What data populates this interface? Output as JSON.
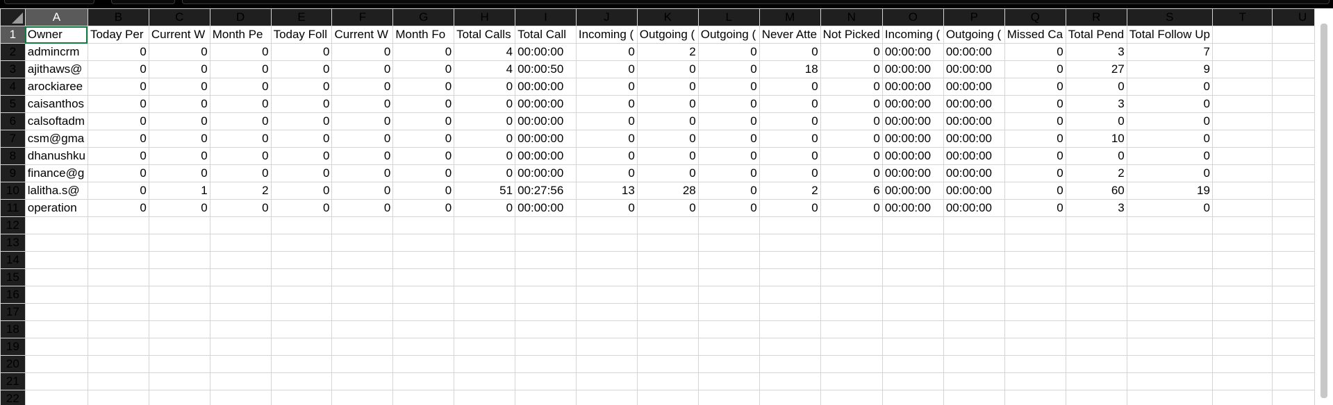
{
  "columns": [
    "A",
    "B",
    "C",
    "D",
    "E",
    "F",
    "G",
    "H",
    "I",
    "J",
    "K",
    "L",
    "M",
    "N",
    "O",
    "P",
    "Q",
    "R",
    "S",
    "T",
    "U"
  ],
  "row_numbers": [
    "1",
    "2",
    "3",
    "4",
    "5",
    "6",
    "7",
    "8",
    "9",
    "10",
    "11",
    "12",
    "13",
    "14",
    "15",
    "16",
    "17",
    "18",
    "19",
    "20",
    "21",
    "22"
  ],
  "header_row": [
    "Owner",
    "Today Per",
    "Current W",
    "Month Pe",
    "Today Foll",
    "Current W",
    "Month Fo",
    "Total Calls",
    "Total Call",
    "Incoming (",
    "Outgoing (",
    "Outgoing (",
    "Never Atte",
    "Not Picked",
    "Incoming (",
    "Outgoing (",
    "Missed Ca",
    "Total Pend",
    "Total Follow Up",
    "",
    ""
  ],
  "rows": [
    [
      "admincrm",
      "0",
      "0",
      "0",
      "0",
      "0",
      "0",
      "4",
      "00:00:00",
      "0",
      "2",
      "0",
      "0",
      "0",
      "00:00:00",
      "00:00:00",
      "0",
      "3",
      "7",
      "",
      ""
    ],
    [
      "ajithaws@",
      "0",
      "0",
      "0",
      "0",
      "0",
      "0",
      "4",
      "00:00:50",
      "0",
      "0",
      "0",
      "18",
      "0",
      "00:00:00",
      "00:00:00",
      "0",
      "27",
      "9",
      "",
      ""
    ],
    [
      "arockiaree",
      "0",
      "0",
      "0",
      "0",
      "0",
      "0",
      "0",
      "00:00:00",
      "0",
      "0",
      "0",
      "0",
      "0",
      "00:00:00",
      "00:00:00",
      "0",
      "0",
      "0",
      "",
      ""
    ],
    [
      "caisanthos",
      "0",
      "0",
      "0",
      "0",
      "0",
      "0",
      "0",
      "00:00:00",
      "0",
      "0",
      "0",
      "0",
      "0",
      "00:00:00",
      "00:00:00",
      "0",
      "3",
      "0",
      "",
      ""
    ],
    [
      "calsoftadm",
      "0",
      "0",
      "0",
      "0",
      "0",
      "0",
      "0",
      "00:00:00",
      "0",
      "0",
      "0",
      "0",
      "0",
      "00:00:00",
      "00:00:00",
      "0",
      "0",
      "0",
      "",
      ""
    ],
    [
      "csm@gma",
      "0",
      "0",
      "0",
      "0",
      "0",
      "0",
      "0",
      "00:00:00",
      "0",
      "0",
      "0",
      "0",
      "0",
      "00:00:00",
      "00:00:00",
      "0",
      "10",
      "0",
      "",
      ""
    ],
    [
      "dhanushku",
      "0",
      "0",
      "0",
      "0",
      "0",
      "0",
      "0",
      "00:00:00",
      "0",
      "0",
      "0",
      "0",
      "0",
      "00:00:00",
      "00:00:00",
      "0",
      "0",
      "0",
      "",
      ""
    ],
    [
      "finance@g",
      "0",
      "0",
      "0",
      "0",
      "0",
      "0",
      "0",
      "00:00:00",
      "0",
      "0",
      "0",
      "0",
      "0",
      "00:00:00",
      "00:00:00",
      "0",
      "2",
      "0",
      "",
      ""
    ],
    [
      "lalitha.s@",
      "0",
      "1",
      "2",
      "0",
      "0",
      "0",
      "51",
      "00:27:56",
      "13",
      "28",
      "0",
      "2",
      "6",
      "00:00:00",
      "00:00:00",
      "0",
      "60",
      "19",
      "",
      ""
    ],
    [
      "operation",
      "0",
      "0",
      "0",
      "0",
      "0",
      "0",
      "0",
      "00:00:00",
      "0",
      "0",
      "0",
      "0",
      "0",
      "00:00:00",
      "00:00:00",
      "0",
      "3",
      "0",
      "",
      ""
    ]
  ],
  "active_cell": "A1",
  "accent_color": "#107c41"
}
